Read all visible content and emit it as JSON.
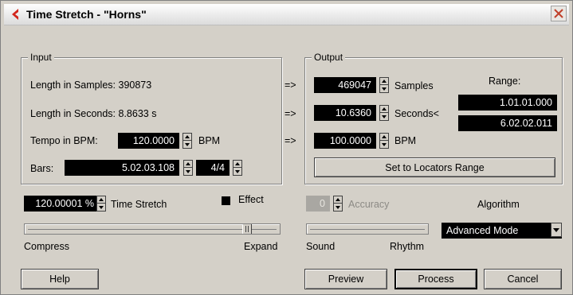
{
  "window": {
    "title": "Time Stretch - \"Horns\""
  },
  "input": {
    "group_label": "Input",
    "length_samples": "Length in Samples: 390873",
    "length_seconds": "Length in Seconds: 8.8633 s",
    "tempo_label": "Tempo in BPM:",
    "tempo_value": "120.0000",
    "tempo_unit": "BPM",
    "bars_label": "Bars:",
    "bars_value": "5.02.03.108",
    "signature_value": "4/4"
  },
  "arrows": [
    "=>",
    "=>",
    "=>"
  ],
  "output": {
    "group_label": "Output",
    "samples_value": "469047",
    "samples_label": "Samples",
    "seconds_value": "10.6360",
    "seconds_label": "Seconds<",
    "bpm_value": "100.0000",
    "bpm_label": "BPM",
    "range_label": "Range:",
    "range_start": "1.01.01.000",
    "range_end": "6.02.02.011",
    "locators_button": "Set to Locators Range"
  },
  "stretch": {
    "value": "120.00001 %",
    "label": "Time Stretch",
    "effect_label": "Effect",
    "compress_label": "Compress",
    "expand_label": "Expand",
    "slider_level": 0.88
  },
  "accuracy": {
    "value": "0",
    "label": "Accuracy",
    "sound_label": "Sound",
    "rhythm_label": "Rhythm"
  },
  "algorithm": {
    "label": "Algorithm",
    "selected": "Advanced Mode"
  },
  "buttons": {
    "help": "Help",
    "preview": "Preview",
    "process": "Process",
    "cancel": "Cancel"
  }
}
